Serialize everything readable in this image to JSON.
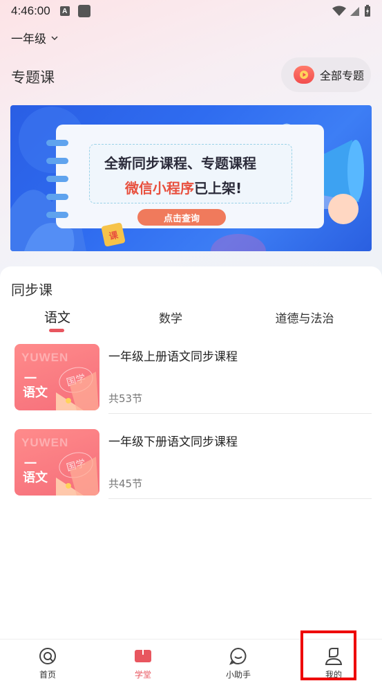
{
  "status_bar": {
    "time": "4:46:00",
    "a_icon": "A"
  },
  "header": {
    "grade": "一年级"
  },
  "topics": {
    "title": "专题课",
    "all_button": "全部专题"
  },
  "banner": {
    "line1": "全新同步课程、专题课程",
    "line2_red": "微信小程序",
    "line2_dark": "已上架!",
    "button": "点击查询",
    "badge": "课"
  },
  "sync": {
    "title": "同步课",
    "tabs": [
      {
        "label": "语文",
        "active": true
      },
      {
        "label": "数学",
        "active": false
      },
      {
        "label": "道德与法治",
        "active": false
      }
    ],
    "courses": [
      {
        "title": "一年级上册语文同步课程",
        "count": "共53节",
        "thumb_en": "YUWEN",
        "thumb_yi": "一",
        "thumb_cn": "语文",
        "thumb_seal": "国学"
      },
      {
        "title": "一年级下册语文同步课程",
        "count": "共45节",
        "thumb_en": "YUWEN",
        "thumb_yi": "一",
        "thumb_cn": "语文",
        "thumb_seal": "国学"
      }
    ]
  },
  "nav": {
    "items": [
      {
        "label": "首页",
        "icon": "home-icon",
        "active": false
      },
      {
        "label": "学堂",
        "icon": "book-icon",
        "active": true
      },
      {
        "label": "小助手",
        "icon": "chat-icon",
        "active": false
      },
      {
        "label": "我的",
        "icon": "profile-icon",
        "active": false
      }
    ]
  },
  "colors": {
    "accent": "#e8565f",
    "banner_blue": "#2f6cf0",
    "highlight": "#ee0000"
  }
}
